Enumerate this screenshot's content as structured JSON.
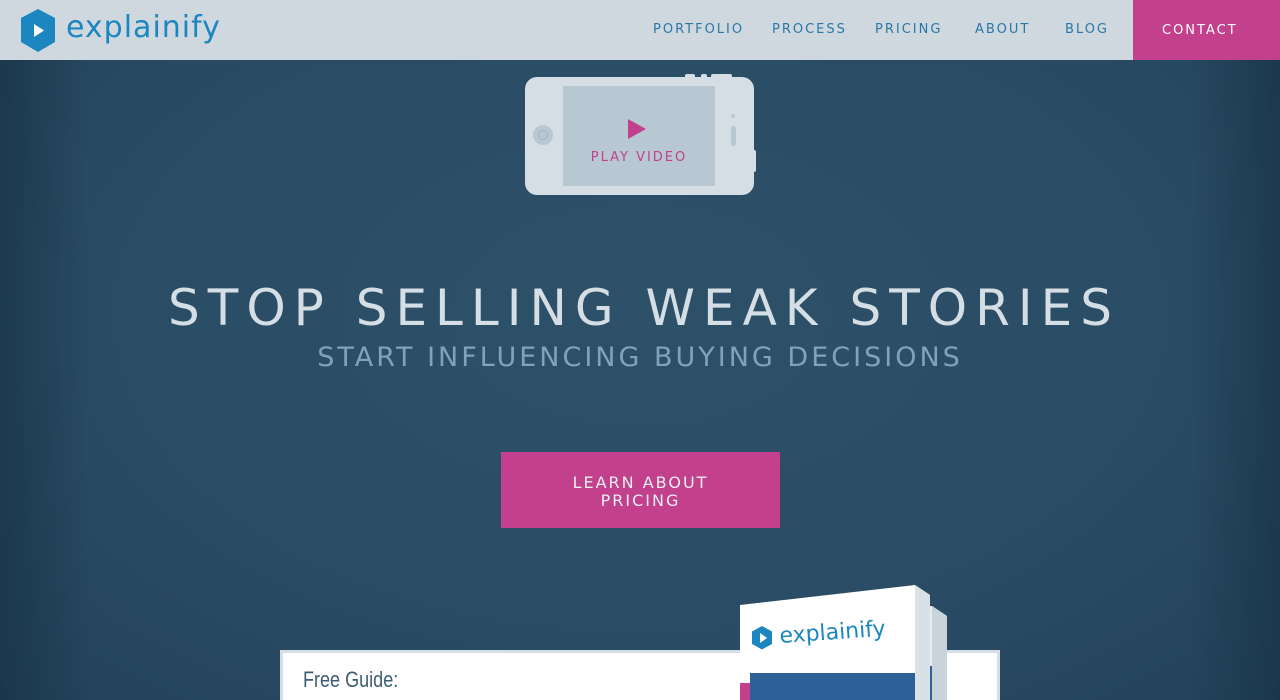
{
  "brand": {
    "name": "explainify",
    "accent_color": "#c2408c",
    "brand_blue": "#1b86bf",
    "logo_icon": "play-hexagon-icon"
  },
  "nav": {
    "items": [
      {
        "label": "PORTFOLIO"
      },
      {
        "label": "PROCESS"
      },
      {
        "label": "PRICING"
      },
      {
        "label": "ABOUT"
      },
      {
        "label": "BLOG"
      }
    ],
    "contact_label": "CONTACT"
  },
  "hero": {
    "video": {
      "label": "PLAY VIDEO",
      "icon": "play-icon"
    },
    "headline": "STOP SELLING WEAK STORIES",
    "subheadline": "START INFLUENCING BUYING DECISIONS",
    "cta": {
      "line1": "LEARN ABOUT",
      "line2": "PRICING"
    }
  },
  "guide": {
    "title": "Free Guide:",
    "book_brand": "explainify"
  }
}
